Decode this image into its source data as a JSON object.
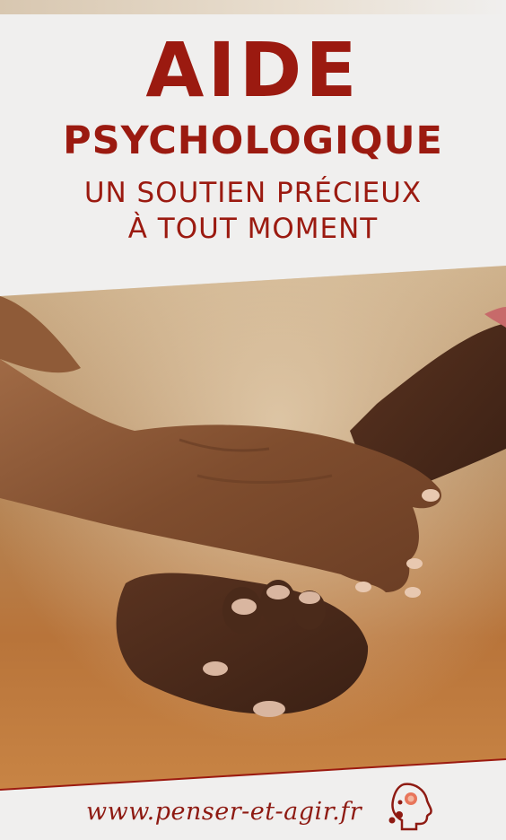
{
  "header": {
    "title_main": "AIDE",
    "title_sub": "PSYCHOLOGIQUE",
    "tagline_line1": "UN SOUTIEN PRÉCIEUX",
    "tagline_line2": "À TOUT MOMENT"
  },
  "photo": {
    "icon": "holding-hands-photo"
  },
  "footer": {
    "url": "www.penser-et-agir.fr",
    "logo_icon": "head-profile-logo-icon"
  },
  "colors": {
    "brand_red": "#9b1a10",
    "background": "#f0efee"
  }
}
